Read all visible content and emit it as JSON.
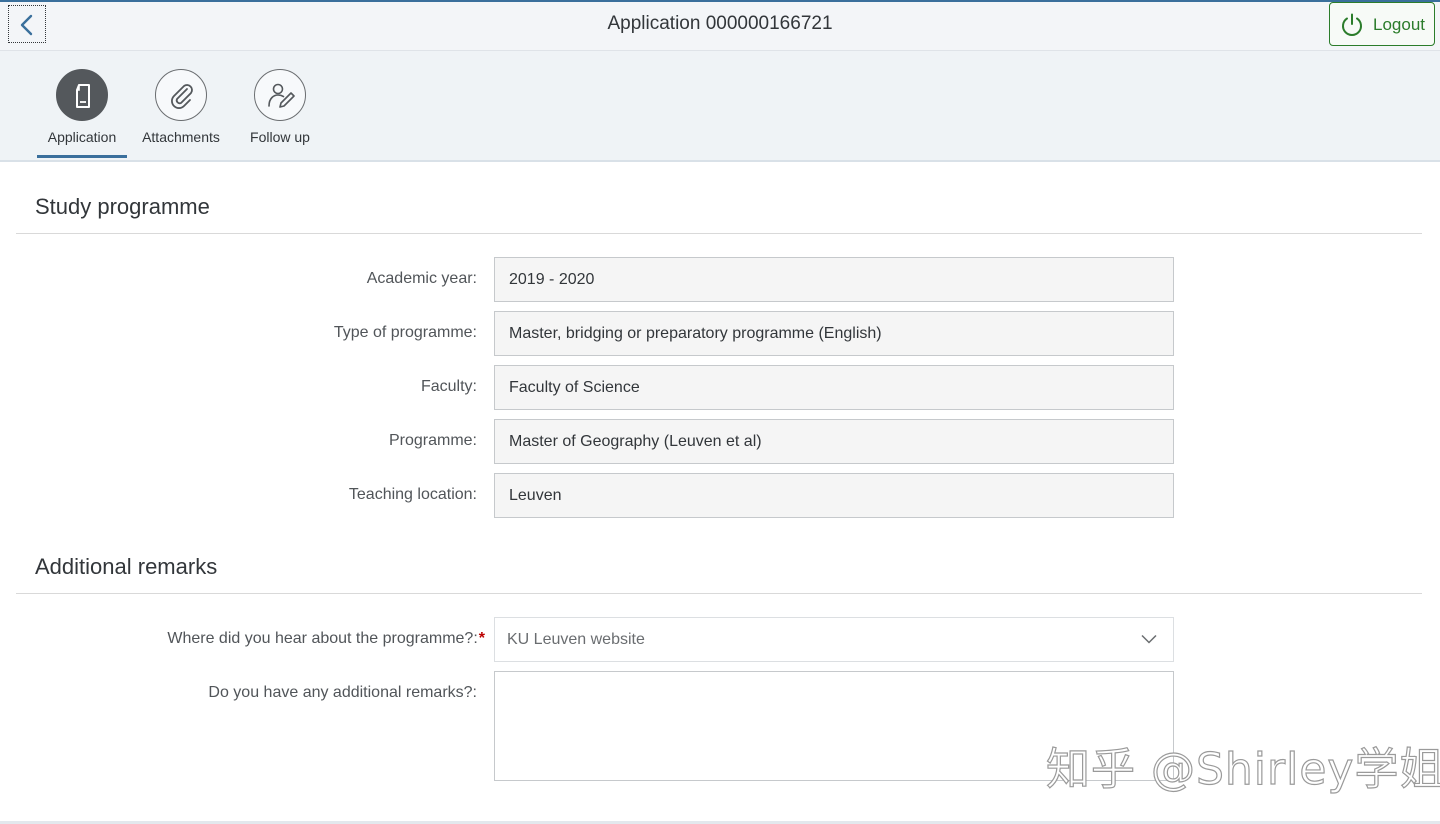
{
  "header": {
    "title": "Application 000000166721",
    "back_icon": "chevron-left-icon",
    "logout_label": "Logout",
    "logout_icon": "power-icon",
    "accent_color": "#3a6f9c",
    "logout_color": "#2b7c2b"
  },
  "tabs": [
    {
      "label": "Application",
      "icon": "document-icon",
      "active": true
    },
    {
      "label": "Attachments",
      "icon": "paperclip-icon",
      "active": false
    },
    {
      "label": "Follow up",
      "icon": "person-edit-icon",
      "active": false
    }
  ],
  "study": {
    "section_title": "Study programme",
    "fields": [
      {
        "label": "Academic year:",
        "value": "2019 - 2020"
      },
      {
        "label": "Type of programme:",
        "value": "Master, bridging or preparatory programme (English)"
      },
      {
        "label": "Faculty:",
        "value": "Faculty of Science"
      },
      {
        "label": "Programme:",
        "value": "Master of Geography (Leuven et al)"
      },
      {
        "label": "Teaching location:",
        "value": "Leuven"
      }
    ]
  },
  "remarks": {
    "section_title": "Additional remarks",
    "hear_label": "Where did you hear about the programme?:",
    "hear_required": "*",
    "hear_value": "KU Leuven website",
    "remarks_label": "Do you have any additional remarks?:",
    "remarks_value": ""
  },
  "watermark": "知乎 @Shirley学姐"
}
